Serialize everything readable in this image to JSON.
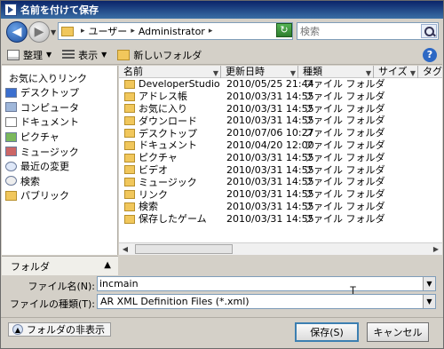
{
  "window": {
    "title": "名前を付けて保存"
  },
  "navbar": {
    "breadcrumb": [
      "ユーザー",
      "Administrator"
    ],
    "search_placeholder": "検索"
  },
  "toolbar": {
    "organize_label": "整理",
    "views_label": "表示",
    "new_folder_label": "新しいフォルダ"
  },
  "navpane": {
    "header": "お気に入りリンク",
    "items": [
      {
        "label": "デスクトップ",
        "icon": "desktop-icon"
      },
      {
        "label": "コンピュータ",
        "icon": "computer-icon"
      },
      {
        "label": "ドキュメント",
        "icon": "documents-icon"
      },
      {
        "label": "ピクチャ",
        "icon": "pictures-icon"
      },
      {
        "label": "ミュージック",
        "icon": "music-icon"
      },
      {
        "label": "最近の変更",
        "icon": "recent-icon"
      },
      {
        "label": "検索",
        "icon": "search-icon"
      },
      {
        "label": "パブリック",
        "icon": "public-folder-icon"
      }
    ],
    "folders_label": "フォルダ"
  },
  "filelist": {
    "columns": [
      "名前",
      "更新日時",
      "種類",
      "サイズ",
      "タグ"
    ],
    "rows": [
      {
        "name": "DeveloperStudio",
        "date": "2010/05/25 21:44",
        "type": "ファイル フォルダ"
      },
      {
        "name": "アドレス帳",
        "date": "2010/03/31 14:55",
        "type": "ファイル フォルダ"
      },
      {
        "name": "お気に入り",
        "date": "2010/03/31 14:55",
        "type": "ファイル フォルダ"
      },
      {
        "name": "ダウンロード",
        "date": "2010/03/31 14:55",
        "type": "ファイル フォルダ"
      },
      {
        "name": "デスクトップ",
        "date": "2010/07/06 10:27",
        "type": "ファイル フォルダ"
      },
      {
        "name": "ドキュメント",
        "date": "2010/04/20 12:00",
        "type": "ファイル フォルダ"
      },
      {
        "name": "ピクチャ",
        "date": "2010/03/31 14:55",
        "type": "ファイル フォルダ"
      },
      {
        "name": "ビデオ",
        "date": "2010/03/31 14:55",
        "type": "ファイル フォルダ"
      },
      {
        "name": "ミュージック",
        "date": "2010/03/31 14:55",
        "type": "ファイル フォルダ"
      },
      {
        "name": "リンク",
        "date": "2010/03/31 14:55",
        "type": "ファイル フォルダ"
      },
      {
        "name": "検索",
        "date": "2010/03/31 14:55",
        "type": "ファイル フォルダ"
      },
      {
        "name": "保存したゲーム",
        "date": "2010/03/31 14:55",
        "type": "ファイル フォルダ"
      }
    ]
  },
  "form": {
    "filename_label": "ファイル名(N):",
    "filename_value": "incmain",
    "filetype_label": "ファイルの種類(T):",
    "filetype_value": "AR XML Definition Files (*.xml)"
  },
  "footer": {
    "hide_folders_label": "フォルダの非表示",
    "save_label": "保存(S)",
    "cancel_label": "キャンセル"
  }
}
